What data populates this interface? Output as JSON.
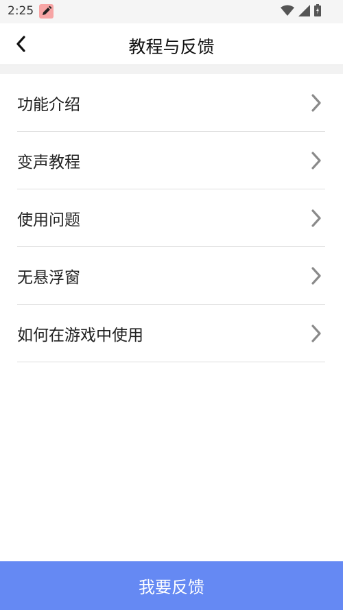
{
  "status_bar": {
    "time": "2:25",
    "icons": [
      "edit-app-icon",
      "wifi-icon",
      "cell-signal-icon",
      "battery-icon"
    ]
  },
  "nav": {
    "title": "教程与反馈",
    "back_icon": "chevron-left-icon"
  },
  "menu": {
    "items": [
      {
        "label": "功能介绍",
        "icon": "chevron-right-icon"
      },
      {
        "label": "变声教程",
        "icon": "chevron-right-icon"
      },
      {
        "label": "使用问题",
        "icon": "chevron-right-icon"
      },
      {
        "label": "无悬浮窗",
        "icon": "chevron-right-icon"
      },
      {
        "label": "如何在游戏中使用",
        "icon": "chevron-right-icon"
      }
    ]
  },
  "footer": {
    "feedback_label": "我要反馈",
    "accent_color": "#6589f3"
  }
}
